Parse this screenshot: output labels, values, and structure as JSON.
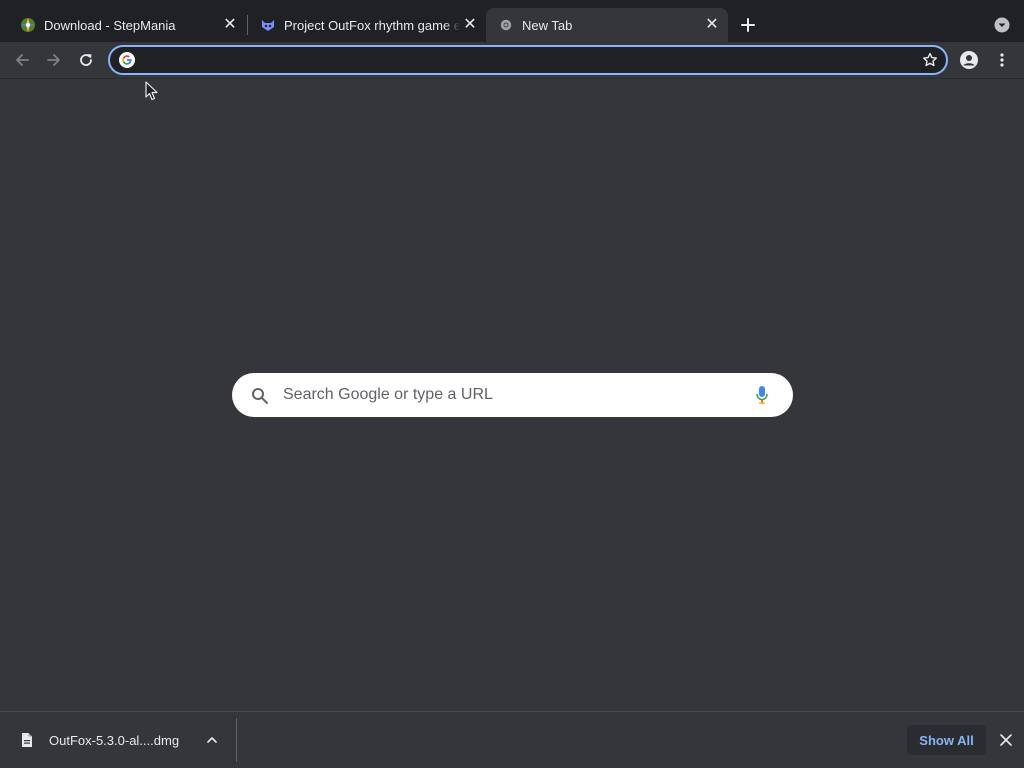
{
  "tabs": [
    {
      "title": "Download - StepMania",
      "favicon": "stepmania-icon",
      "close": "✕"
    },
    {
      "title": "Project OutFox rhythm game engine",
      "favicon": "outfox-icon",
      "close": "✕"
    },
    {
      "title": "New Tab",
      "favicon": "chrome-icon",
      "close": "✕",
      "active": true
    }
  ],
  "toolbar": {
    "back_icon": "back-arrow-icon",
    "forward_icon": "forward-arrow-icon",
    "reload_icon": "reload-icon",
    "omnibox_value": "",
    "omnibox_placeholder": "",
    "bookmark_icon": "star-icon",
    "profile_icon": "profile-icon",
    "menu_icon": "kebab-menu-icon"
  },
  "search": {
    "placeholder": "Search Google or type a URL",
    "search_icon": "magnifier-icon",
    "mic_icon": "microphone-icon"
  },
  "download_shelf": {
    "filename": "OutFox-5.3.0-al....dmg",
    "show_all_label": "Show All"
  },
  "colors": {
    "tabstrip_bg": "#202124",
    "toolbar_bg": "#35363a",
    "accent": "#8ab4f8",
    "text": "#e8eaed"
  }
}
